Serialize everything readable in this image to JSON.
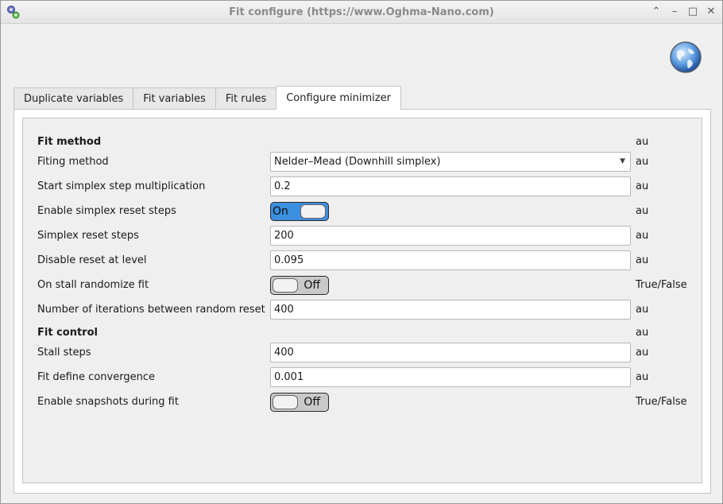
{
  "window": {
    "title": "Fit configure (https://www.Oghma-Nano.com)",
    "app_icon": "gears-icon",
    "controls": [
      {
        "name": "collapse-icon",
        "glyph": "⌃"
      },
      {
        "name": "minimize-icon",
        "glyph": "–"
      },
      {
        "name": "maximize-icon",
        "glyph": "□"
      },
      {
        "name": "close-icon",
        "glyph": "✕"
      }
    ]
  },
  "header": {
    "globe_icon": "globe-icon"
  },
  "tabs": [
    {
      "label": "Duplicate variables",
      "active": false
    },
    {
      "label": "Fit variables",
      "active": false
    },
    {
      "label": "Fit rules",
      "active": false
    },
    {
      "label": "Configure minimizer",
      "active": true
    }
  ],
  "form": {
    "rows": [
      {
        "kind": "header",
        "label": "Fit method",
        "unit": "au"
      },
      {
        "kind": "combo",
        "label": "Fiting method",
        "value": "Nelder–Mead (Downhill simplex)",
        "unit": "au"
      },
      {
        "kind": "text",
        "label": "Start simplex step multiplication",
        "value": "0.2",
        "unit": "au"
      },
      {
        "kind": "toggle",
        "label": "Enable simplex reset steps",
        "value": "On",
        "state": true,
        "unit": "au"
      },
      {
        "kind": "text",
        "label": "Simplex reset steps",
        "value": "200",
        "unit": "au"
      },
      {
        "kind": "text",
        "label": "Disable reset at level",
        "value": "0.095",
        "unit": "au"
      },
      {
        "kind": "toggle",
        "label": "On stall randomize fit",
        "value": "Off",
        "state": false,
        "unit": "True/False"
      },
      {
        "kind": "text",
        "label": "Number of iterations between random reset",
        "value": "400",
        "unit": "au"
      },
      {
        "kind": "header",
        "label": "Fit control",
        "unit": "au"
      },
      {
        "kind": "text",
        "label": "Stall steps",
        "value": "400",
        "unit": "au"
      },
      {
        "kind": "text",
        "label": "Fit define convergence",
        "value": "0.001",
        "unit": "au"
      },
      {
        "kind": "toggle",
        "label": "Enable snapshots during fit",
        "value": "Off",
        "state": false,
        "unit": "True/False"
      }
    ]
  },
  "colors": {
    "toggle_on": "#3d8fe0",
    "toggle_off": "#c9c9c9",
    "panel_bg": "#efefef"
  }
}
